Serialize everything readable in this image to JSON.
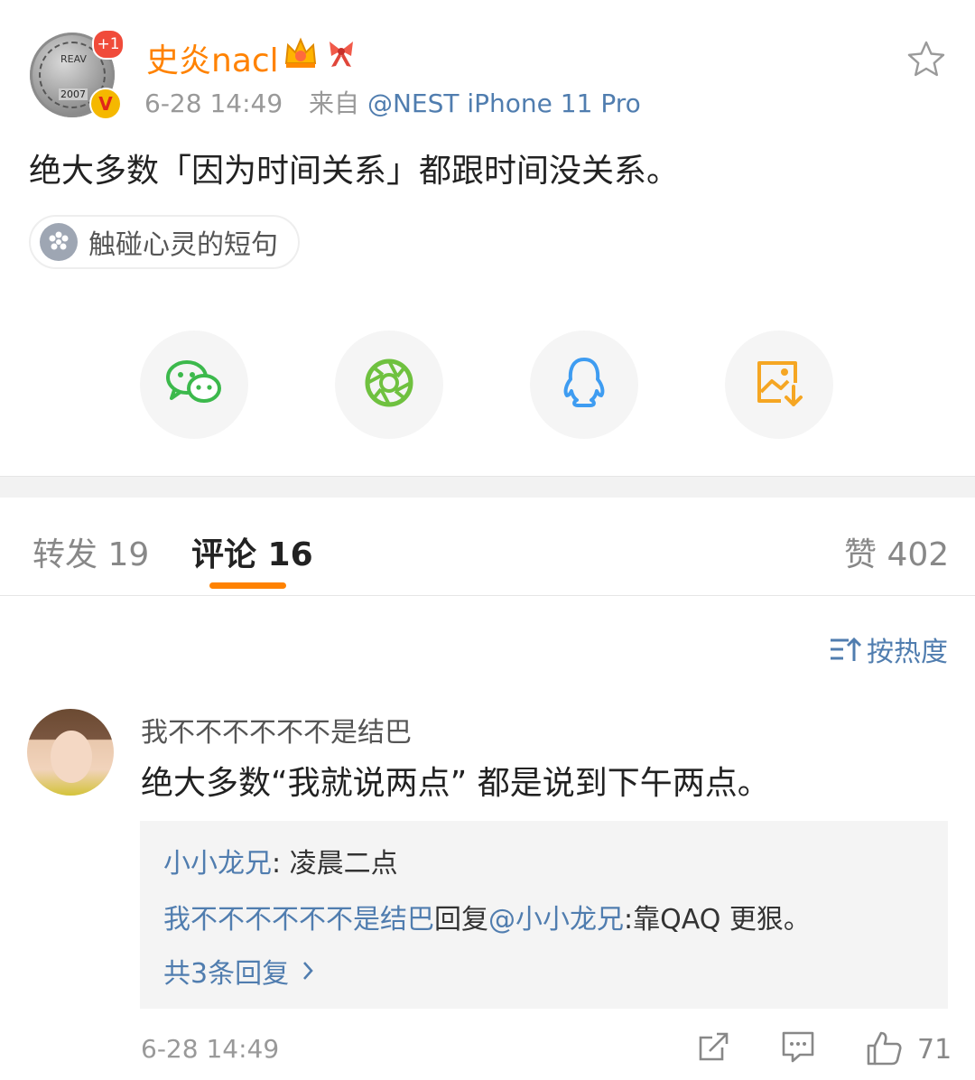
{
  "post": {
    "author": {
      "name": "史炎nacl",
      "notification_badge": "+1",
      "verified_badge": "V",
      "avatar_text_top": "REAV",
      "avatar_text_bottom": "2007"
    },
    "time": "6-28 14:49",
    "source_prefix": "来自",
    "source": "@NEST iPhone 11 Pro",
    "text": "绝大多数「因为时间关系」都跟时间没关系。",
    "topic": "触碰心灵的短句"
  },
  "share": [
    {
      "name": "wechat-icon",
      "color": "#3cb94c"
    },
    {
      "name": "moments-icon",
      "color": "#6fc13f"
    },
    {
      "name": "qq-icon",
      "color": "#3e9cf1"
    },
    {
      "name": "save-image-icon",
      "color": "#f5a623"
    }
  ],
  "tabs": {
    "repost": "转发 19",
    "comments": "评论 16",
    "likes": "赞 402"
  },
  "sort": {
    "label": "按热度"
  },
  "comment": {
    "name": "我不不不不不不是结巴",
    "text": "绝大多数“我就说两点” 都是说到下午两点。",
    "replies": [
      {
        "user": "小小龙兄",
        "sep": ": ",
        "text": "凌晨二点"
      },
      {
        "user": "我不不不不不不是结巴",
        "mid": "回复",
        "mention": "@小小龙兄",
        "text": ":靠QAQ 更狠。"
      }
    ],
    "more_replies": "共3条回复",
    "time": "6-28 14:49",
    "likes": "71"
  },
  "colors": {
    "accent": "#ff8200",
    "link": "#507daf"
  }
}
